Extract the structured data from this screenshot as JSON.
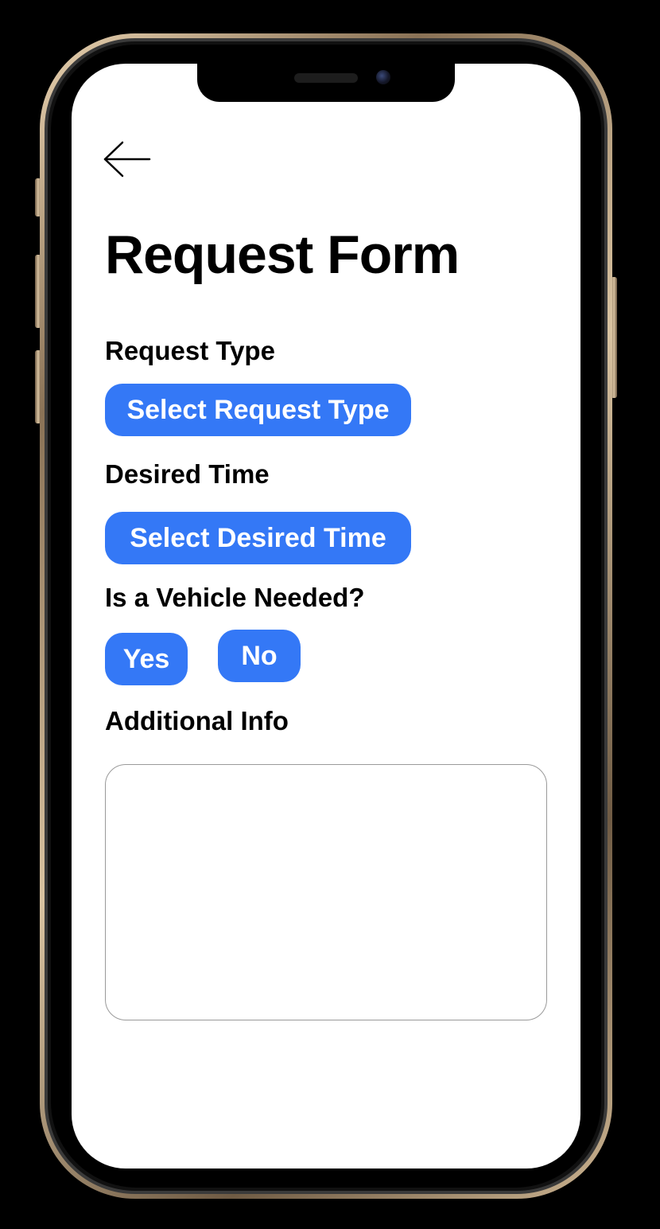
{
  "screen": {
    "title": "Request Form",
    "back_icon": "arrow-left-icon"
  },
  "form": {
    "request_type": {
      "label": "Request Type",
      "button_label": "Select Request Type"
    },
    "desired_time": {
      "label": "Desired Time",
      "button_label": "Select Desired Time"
    },
    "vehicle_needed": {
      "label": "Is a Vehicle Needed?",
      "yes_label": "Yes",
      "no_label": "No"
    },
    "additional_info": {
      "label": "Additional Info",
      "value": "",
      "placeholder": ""
    }
  },
  "colors": {
    "accent": "#3478f6",
    "background": "#ffffff",
    "text": "#000000",
    "border": "#9a9a9a"
  }
}
